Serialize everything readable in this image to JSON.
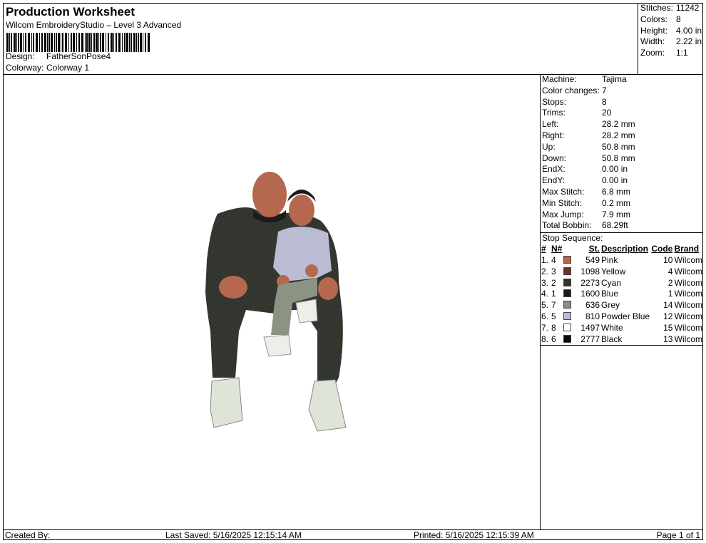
{
  "header": {
    "title": "Production Worksheet",
    "subtitle": "Wilcom EmbroideryStudio – Level 3 Advanced",
    "design_label": "Design:",
    "design_value": "FatherSonPose4",
    "colorway_label": "Colorway:",
    "colorway_value": "Colorway 1"
  },
  "summary": [
    {
      "label": "Stitches:",
      "value": "11242"
    },
    {
      "label": "Colors:",
      "value": "8"
    },
    {
      "label": "Height:",
      "value": "4.00 in"
    },
    {
      "label": "Width:",
      "value": "2.22 in"
    },
    {
      "label": "Zoom:",
      "value": "1:1"
    }
  ],
  "machine_info": [
    {
      "label": "Machine:",
      "value": "Tajima"
    },
    {
      "label": "Color changes:",
      "value": "7"
    },
    {
      "label": "Stops:",
      "value": "8"
    },
    {
      "label": "Trims:",
      "value": "20"
    },
    {
      "label": "Left:",
      "value": "28.2 mm"
    },
    {
      "label": "Right:",
      "value": "28.2 mm"
    },
    {
      "label": "Up:",
      "value": "50.8 mm"
    },
    {
      "label": "Down:",
      "value": "50.8 mm"
    },
    {
      "label": "EndX:",
      "value": "0.00 in"
    },
    {
      "label": "EndY:",
      "value": "0.00 in"
    },
    {
      "label": "Max Stitch:",
      "value": "6.8 mm"
    },
    {
      "label": "Min Stitch:",
      "value": "0.2 mm"
    },
    {
      "label": "Max Jump:",
      "value": "7.9 mm"
    },
    {
      "label": "Total Bobbin:",
      "value": "68.29ft"
    }
  ],
  "stop_sequence": {
    "title": "Stop Sequence:",
    "headers": [
      "#",
      "N#",
      "St.",
      "Description",
      "Code",
      "Brand"
    ],
    "rows": [
      {
        "num": "1.",
        "n": "4",
        "color": "#b5684e",
        "st": "549",
        "desc": "Pink",
        "code": "10",
        "brand": "Wilcom"
      },
      {
        "num": "2.",
        "n": "3",
        "color": "#6e3526",
        "st": "1098",
        "desc": "Yellow",
        "code": "4",
        "brand": "Wilcom"
      },
      {
        "num": "3.",
        "n": "2",
        "color": "#2f332c",
        "st": "2273",
        "desc": "Cyan",
        "code": "2",
        "brand": "Wilcom"
      },
      {
        "num": "4.",
        "n": "1",
        "color": "#1b1b1b",
        "st": "1600",
        "desc": "Blue",
        "code": "1",
        "brand": "Wilcom"
      },
      {
        "num": "5.",
        "n": "7",
        "color": "#8b8b8b",
        "st": "636",
        "desc": "Grey",
        "code": "14",
        "brand": "Wilcom"
      },
      {
        "num": "6.",
        "n": "5",
        "color": "#b9bcd3",
        "st": "810",
        "desc": "Powder Blue",
        "code": "12",
        "brand": "Wilcom"
      },
      {
        "num": "7.",
        "n": "8",
        "color": "#ffffff",
        "st": "1497",
        "desc": "White",
        "code": "15",
        "brand": "Wilcom"
      },
      {
        "num": "8.",
        "n": "6",
        "color": "#0a0a0a",
        "st": "2777",
        "desc": "Black",
        "code": "13",
        "brand": "Wilcom"
      }
    ]
  },
  "footer": {
    "created_by": "Created By:",
    "last_saved": "Last Saved: 5/16/2025 12:15:14 AM",
    "printed": "Printed: 5/16/2025 12:15:39 AM",
    "page": "Page 1 of 1"
  }
}
